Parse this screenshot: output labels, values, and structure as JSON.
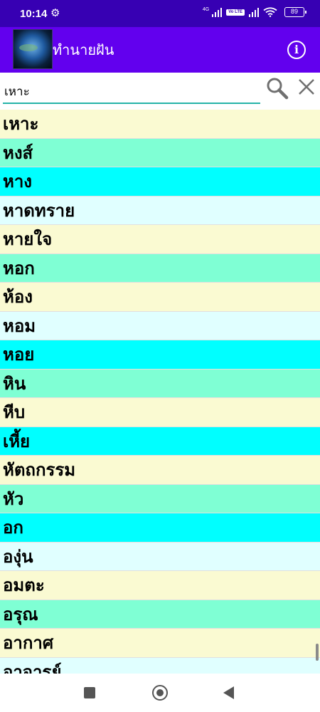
{
  "status_bar": {
    "time": "10:14",
    "network_label": "4G",
    "volte_label": "Vo LTE",
    "battery": "89"
  },
  "app_bar": {
    "title": "ทำนายฝัน"
  },
  "search": {
    "value": "เหาะ"
  },
  "colors": {
    "status_bar": "#3700b3",
    "app_bar": "#6200ee",
    "search_underline": "#26b3a8",
    "row_yellow": "#fafad2",
    "row_aqua": "#7fffd4",
    "row_cyan": "#00ffff",
    "row_azure": "#e0ffff"
  },
  "word_list": {
    "items": [
      {
        "label": "เหาะ",
        "color": "yellow"
      },
      {
        "label": "หงส์",
        "color": "aqua"
      },
      {
        "label": "หาง",
        "color": "cyan"
      },
      {
        "label": "หาดทราย",
        "color": "azure"
      },
      {
        "label": "หายใจ",
        "color": "yellow"
      },
      {
        "label": "หอก",
        "color": "aqua"
      },
      {
        "label": "ห้อง",
        "color": "yellow"
      },
      {
        "label": "หอม",
        "color": "azure"
      },
      {
        "label": "หอย",
        "color": "cyan"
      },
      {
        "label": "หิน",
        "color": "aqua"
      },
      {
        "label": "หีบ",
        "color": "yellow"
      },
      {
        "label": "เหี้ย",
        "color": "cyan"
      },
      {
        "label": "หัตถกรรม",
        "color": "yellow"
      },
      {
        "label": "หัว",
        "color": "aqua"
      },
      {
        "label": "อก",
        "color": "cyan"
      },
      {
        "label": "องุ่น",
        "color": "azure"
      },
      {
        "label": "อมตะ",
        "color": "yellow"
      },
      {
        "label": "อรุณ",
        "color": "aqua"
      },
      {
        "label": "อากาศ",
        "color": "yellow"
      },
      {
        "label": "อาจารย์",
        "color": "azure"
      }
    ]
  }
}
